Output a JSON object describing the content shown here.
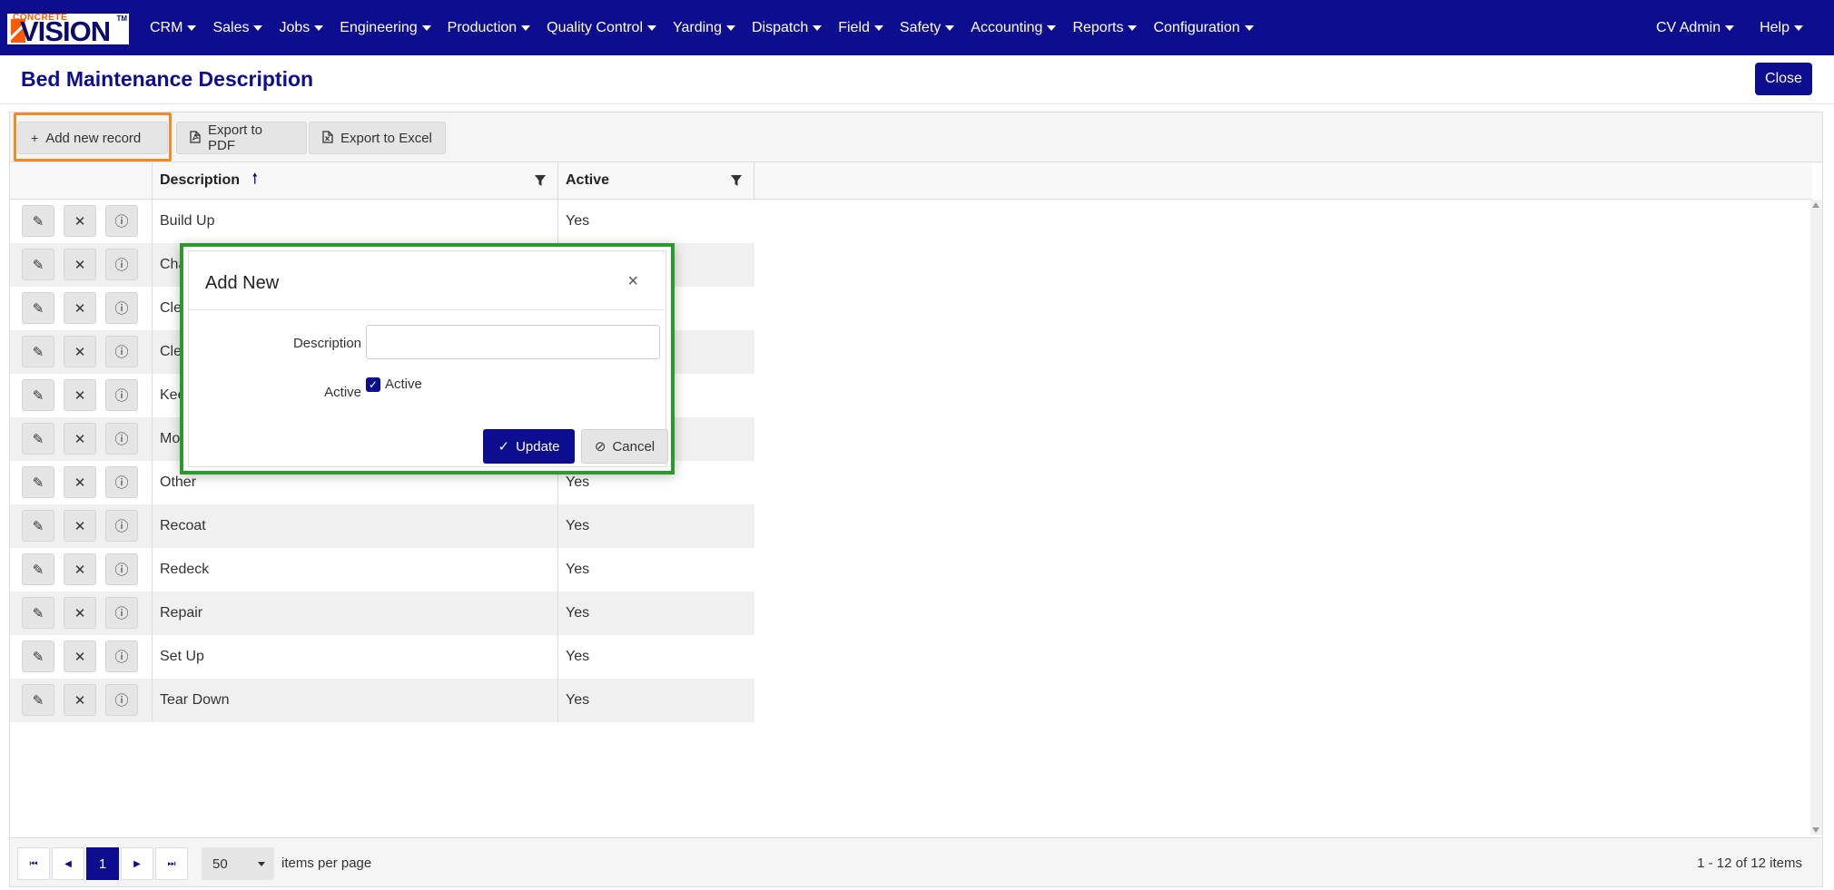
{
  "nav": {
    "logo_small": "CONCRETE",
    "logo_big": "VISION",
    "logo_tm": "TM",
    "menus": [
      "CRM",
      "Sales",
      "Jobs",
      "Engineering",
      "Production",
      "Quality Control",
      "Yarding",
      "Dispatch",
      "Field",
      "Safety",
      "Accounting",
      "Reports",
      "Configuration"
    ],
    "user": "CV Admin",
    "help": "Help"
  },
  "page": {
    "title": "Bed Maintenance Description",
    "close_label": "Close"
  },
  "toolbar": {
    "add_label": "Add new record",
    "pdf_label": "Export to PDF",
    "excel_label": "Export to Excel"
  },
  "grid": {
    "columns": [
      "Description",
      "Active"
    ],
    "rows": [
      {
        "description": "Build Up",
        "active": "Yes"
      },
      {
        "description": "Cha",
        "active": ""
      },
      {
        "description": "Cle",
        "active": ""
      },
      {
        "description": "Cle",
        "active": ""
      },
      {
        "description": "Kee",
        "active": ""
      },
      {
        "description": "Mol",
        "active": ""
      },
      {
        "description": "Other",
        "active": "Yes"
      },
      {
        "description": "Recoat",
        "active": "Yes"
      },
      {
        "description": "Redeck",
        "active": "Yes"
      },
      {
        "description": "Repair",
        "active": "Yes"
      },
      {
        "description": "Set Up",
        "active": "Yes"
      },
      {
        "description": "Tear Down",
        "active": "Yes"
      }
    ]
  },
  "pager": {
    "current_page": "1",
    "per_page": "50",
    "per_page_label": "items per page",
    "info": "1 - 12 of 12 items"
  },
  "modal": {
    "title": "Add New",
    "close_glyph": "×",
    "description_label": "Description",
    "description_value": "",
    "active_label": "Active",
    "active_checkbox_label": "Active",
    "active_checked": true,
    "update_label": "Update",
    "cancel_label": "Cancel"
  },
  "colors": {
    "brand": "#0d0d8f",
    "highlight_orange": "#f08a24",
    "highlight_green": "#2a9a2a"
  }
}
